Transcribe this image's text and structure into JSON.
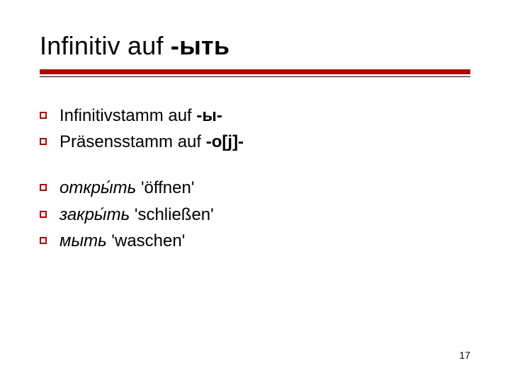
{
  "title_prefix": "Infinitiv auf ",
  "title_bold": "-ыть",
  "group1": [
    {
      "plain": "Infinitivstamm auf ",
      "bold": "-ы-"
    },
    {
      "plain": "Präsensstamm auf ",
      "bold": "-o[j]-"
    }
  ],
  "group2": [
    {
      "italic": "откры́ть",
      "gloss": " 'öffnen'"
    },
    {
      "italic": "закры́ть",
      "gloss": " 'schließen'"
    },
    {
      "italic": "мыть",
      "gloss": " 'waschen'"
    }
  ],
  "page_number": "17"
}
